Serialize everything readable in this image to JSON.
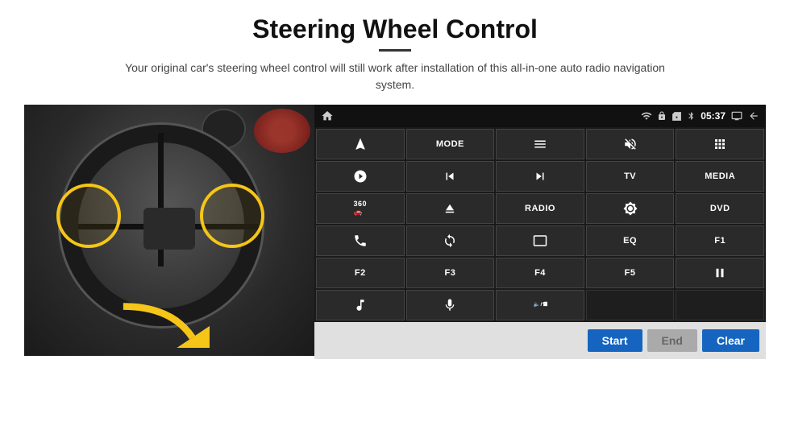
{
  "header": {
    "title": "Steering Wheel Control",
    "subtitle": "Your original car's steering wheel control will still work after installation of this all-in-one auto radio navigation system."
  },
  "status_bar": {
    "time": "05:37",
    "wifi_icon": "wifi",
    "lock_icon": "lock",
    "sim_icon": "sim",
    "bt_icon": "bluetooth",
    "screen_icon": "screen",
    "back_icon": "back"
  },
  "buttons": [
    {
      "label": "",
      "icon": "navigation-arrow",
      "row": 1,
      "col": 1
    },
    {
      "label": "MODE",
      "icon": "",
      "row": 1,
      "col": 2
    },
    {
      "label": "",
      "icon": "list",
      "row": 1,
      "col": 3
    },
    {
      "label": "",
      "icon": "mute",
      "row": 1,
      "col": 4
    },
    {
      "label": "",
      "icon": "grid-apps",
      "row": 1,
      "col": 5
    },
    {
      "label": "",
      "icon": "settings-circle",
      "row": 2,
      "col": 1
    },
    {
      "label": "",
      "icon": "prev-track",
      "row": 2,
      "col": 2
    },
    {
      "label": "",
      "icon": "next-track",
      "row": 2,
      "col": 3
    },
    {
      "label": "TV",
      "icon": "",
      "row": 2,
      "col": 4
    },
    {
      "label": "MEDIA",
      "icon": "",
      "row": 2,
      "col": 5
    },
    {
      "label": "",
      "icon": "360-cam",
      "row": 3,
      "col": 1
    },
    {
      "label": "",
      "icon": "eject",
      "row": 3,
      "col": 2
    },
    {
      "label": "RADIO",
      "icon": "",
      "row": 3,
      "col": 3
    },
    {
      "label": "",
      "icon": "brightness",
      "row": 3,
      "col": 4
    },
    {
      "label": "DVD",
      "icon": "",
      "row": 3,
      "col": 5
    },
    {
      "label": "",
      "icon": "phone",
      "row": 4,
      "col": 1
    },
    {
      "label": "",
      "icon": "swirl",
      "row": 4,
      "col": 2
    },
    {
      "label": "",
      "icon": "window",
      "row": 4,
      "col": 3
    },
    {
      "label": "EQ",
      "icon": "",
      "row": 4,
      "col": 4
    },
    {
      "label": "F1",
      "icon": "",
      "row": 4,
      "col": 5
    },
    {
      "label": "F2",
      "icon": "",
      "row": 5,
      "col": 1
    },
    {
      "label": "F3",
      "icon": "",
      "row": 5,
      "col": 2
    },
    {
      "label": "F4",
      "icon": "",
      "row": 5,
      "col": 3
    },
    {
      "label": "F5",
      "icon": "",
      "row": 5,
      "col": 4
    },
    {
      "label": "",
      "icon": "play-pause",
      "row": 5,
      "col": 5
    },
    {
      "label": "",
      "icon": "music-note",
      "row": 6,
      "col": 1
    },
    {
      "label": "",
      "icon": "microphone",
      "row": 6,
      "col": 2
    },
    {
      "label": "",
      "icon": "volume-phone",
      "row": 6,
      "col": 3
    },
    {
      "label": "",
      "icon": "",
      "row": 6,
      "col": 4
    },
    {
      "label": "",
      "icon": "",
      "row": 6,
      "col": 5
    }
  ],
  "action_bar": {
    "start_label": "Start",
    "end_label": "End",
    "clear_label": "Clear"
  }
}
